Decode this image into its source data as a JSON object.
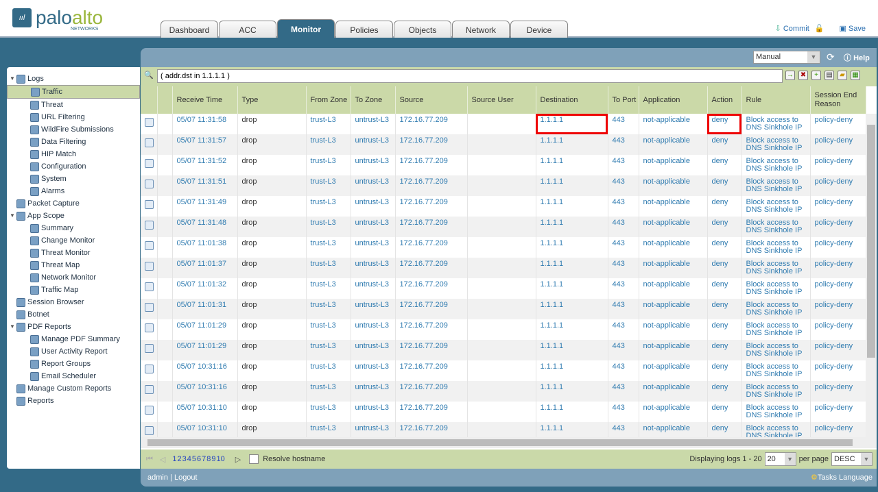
{
  "brand": {
    "name_1": "palo",
    "name_2": "alto",
    "sub": "NETWORKS"
  },
  "tabs": [
    "Dashboard",
    "ACC",
    "Monitor",
    "Policies",
    "Objects",
    "Network",
    "Device"
  ],
  "active_tab": "Monitor",
  "header_actions": {
    "commit": "Commit",
    "save": "Save"
  },
  "toolbar": {
    "refresh_mode": "Manual",
    "help": "Help"
  },
  "filter": {
    "value": "( addr.dst in 1.1.1.1 )"
  },
  "sidebar": [
    {
      "label": "Logs",
      "level": 0,
      "expand": "▼"
    },
    {
      "label": "Traffic",
      "level": 1,
      "selected": true
    },
    {
      "label": "Threat",
      "level": 1
    },
    {
      "label": "URL Filtering",
      "level": 1
    },
    {
      "label": "WildFire Submissions",
      "level": 1
    },
    {
      "label": "Data Filtering",
      "level": 1
    },
    {
      "label": "HIP Match",
      "level": 1
    },
    {
      "label": "Configuration",
      "level": 1
    },
    {
      "label": "System",
      "level": 1
    },
    {
      "label": "Alarms",
      "level": 1
    },
    {
      "label": "Packet Capture",
      "level": 0
    },
    {
      "label": "App Scope",
      "level": 0,
      "expand": "▼"
    },
    {
      "label": "Summary",
      "level": 1
    },
    {
      "label": "Change Monitor",
      "level": 1
    },
    {
      "label": "Threat Monitor",
      "level": 1
    },
    {
      "label": "Threat Map",
      "level": 1
    },
    {
      "label": "Network Monitor",
      "level": 1
    },
    {
      "label": "Traffic Map",
      "level": 1
    },
    {
      "label": "Session Browser",
      "level": 0
    },
    {
      "label": "Botnet",
      "level": 0
    },
    {
      "label": "PDF Reports",
      "level": 0,
      "expand": "▼"
    },
    {
      "label": "Manage PDF Summary",
      "level": 1
    },
    {
      "label": "User Activity Report",
      "level": 1
    },
    {
      "label": "Report Groups",
      "level": 1
    },
    {
      "label": "Email Scheduler",
      "level": 1
    },
    {
      "label": "Manage Custom Reports",
      "level": 0
    },
    {
      "label": "Reports",
      "level": 0
    }
  ],
  "table": {
    "columns": [
      "Receive Time",
      "Type",
      "From Zone",
      "To Zone",
      "Source",
      "Source User",
      "Destination",
      "To Port",
      "Application",
      "Action",
      "Rule",
      "Session End Reason"
    ],
    "rows": [
      [
        "05/07 11:31:58",
        "drop",
        "trust-L3",
        "untrust-L3",
        "172.16.77.209",
        "",
        "1.1.1.1",
        "443",
        "not-applicable",
        "deny",
        "Block access to DNS Sinkhole IP",
        "policy-deny"
      ],
      [
        "05/07 11:31:57",
        "drop",
        "trust-L3",
        "untrust-L3",
        "172.16.77.209",
        "",
        "1.1.1.1",
        "443",
        "not-applicable",
        "deny",
        "Block access to DNS Sinkhole IP",
        "policy-deny"
      ],
      [
        "05/07 11:31:52",
        "drop",
        "trust-L3",
        "untrust-L3",
        "172.16.77.209",
        "",
        "1.1.1.1",
        "443",
        "not-applicable",
        "deny",
        "Block access to DNS Sinkhole IP",
        "policy-deny"
      ],
      [
        "05/07 11:31:51",
        "drop",
        "trust-L3",
        "untrust-L3",
        "172.16.77.209",
        "",
        "1.1.1.1",
        "443",
        "not-applicable",
        "deny",
        "Block access to DNS Sinkhole IP",
        "policy-deny"
      ],
      [
        "05/07 11:31:49",
        "drop",
        "trust-L3",
        "untrust-L3",
        "172.16.77.209",
        "",
        "1.1.1.1",
        "443",
        "not-applicable",
        "deny",
        "Block access to DNS Sinkhole IP",
        "policy-deny"
      ],
      [
        "05/07 11:31:48",
        "drop",
        "trust-L3",
        "untrust-L3",
        "172.16.77.209",
        "",
        "1.1.1.1",
        "443",
        "not-applicable",
        "deny",
        "Block access to DNS Sinkhole IP",
        "policy-deny"
      ],
      [
        "05/07 11:01:38",
        "drop",
        "trust-L3",
        "untrust-L3",
        "172.16.77.209",
        "",
        "1.1.1.1",
        "443",
        "not-applicable",
        "deny",
        "Block access to DNS Sinkhole IP",
        "policy-deny"
      ],
      [
        "05/07 11:01:37",
        "drop",
        "trust-L3",
        "untrust-L3",
        "172.16.77.209",
        "",
        "1.1.1.1",
        "443",
        "not-applicable",
        "deny",
        "Block access to DNS Sinkhole IP",
        "policy-deny"
      ],
      [
        "05/07 11:01:32",
        "drop",
        "trust-L3",
        "untrust-L3",
        "172.16.77.209",
        "",
        "1.1.1.1",
        "443",
        "not-applicable",
        "deny",
        "Block access to DNS Sinkhole IP",
        "policy-deny"
      ],
      [
        "05/07 11:01:31",
        "drop",
        "trust-L3",
        "untrust-L3",
        "172.16.77.209",
        "",
        "1.1.1.1",
        "443",
        "not-applicable",
        "deny",
        "Block access to DNS Sinkhole IP",
        "policy-deny"
      ],
      [
        "05/07 11:01:29",
        "drop",
        "trust-L3",
        "untrust-L3",
        "172.16.77.209",
        "",
        "1.1.1.1",
        "443",
        "not-applicable",
        "deny",
        "Block access to DNS Sinkhole IP",
        "policy-deny"
      ],
      [
        "05/07 11:01:29",
        "drop",
        "trust-L3",
        "untrust-L3",
        "172.16.77.209",
        "",
        "1.1.1.1",
        "443",
        "not-applicable",
        "deny",
        "Block access to DNS Sinkhole IP",
        "policy-deny"
      ],
      [
        "05/07 10:31:16",
        "drop",
        "trust-L3",
        "untrust-L3",
        "172.16.77.209",
        "",
        "1.1.1.1",
        "443",
        "not-applicable",
        "deny",
        "Block access to DNS Sinkhole IP",
        "policy-deny"
      ],
      [
        "05/07 10:31:16",
        "drop",
        "trust-L3",
        "untrust-L3",
        "172.16.77.209",
        "",
        "1.1.1.1",
        "443",
        "not-applicable",
        "deny",
        "Block access to DNS Sinkhole IP",
        "policy-deny"
      ],
      [
        "05/07 10:31:10",
        "drop",
        "trust-L3",
        "untrust-L3",
        "172.16.77.209",
        "",
        "1.1.1.1",
        "443",
        "not-applicable",
        "deny",
        "Block access to DNS Sinkhole IP",
        "policy-deny"
      ],
      [
        "05/07 10:31:10",
        "drop",
        "trust-L3",
        "untrust-L3",
        "172.16.77.209",
        "",
        "1.1.1.1",
        "443",
        "not-applicable",
        "deny",
        "Block access to DNS Sinkhole IP",
        "policy-deny"
      ]
    ]
  },
  "pager": {
    "pages": [
      "1",
      "2",
      "3",
      "4",
      "5",
      "6",
      "7",
      "8",
      "9",
      "10"
    ],
    "resolve_hostname": "Resolve hostname",
    "displaying": "Displaying logs 1 - 20",
    "per_page_value": "20",
    "per_page": "per page",
    "sort": "DESC"
  },
  "status": {
    "user": "admin",
    "logout": "Logout",
    "tasks": "Tasks",
    "language": "Language"
  },
  "colors": {
    "brand_blue": "#336a87",
    "brand_green": "#9ab63c",
    "highlight": "#e00000"
  }
}
